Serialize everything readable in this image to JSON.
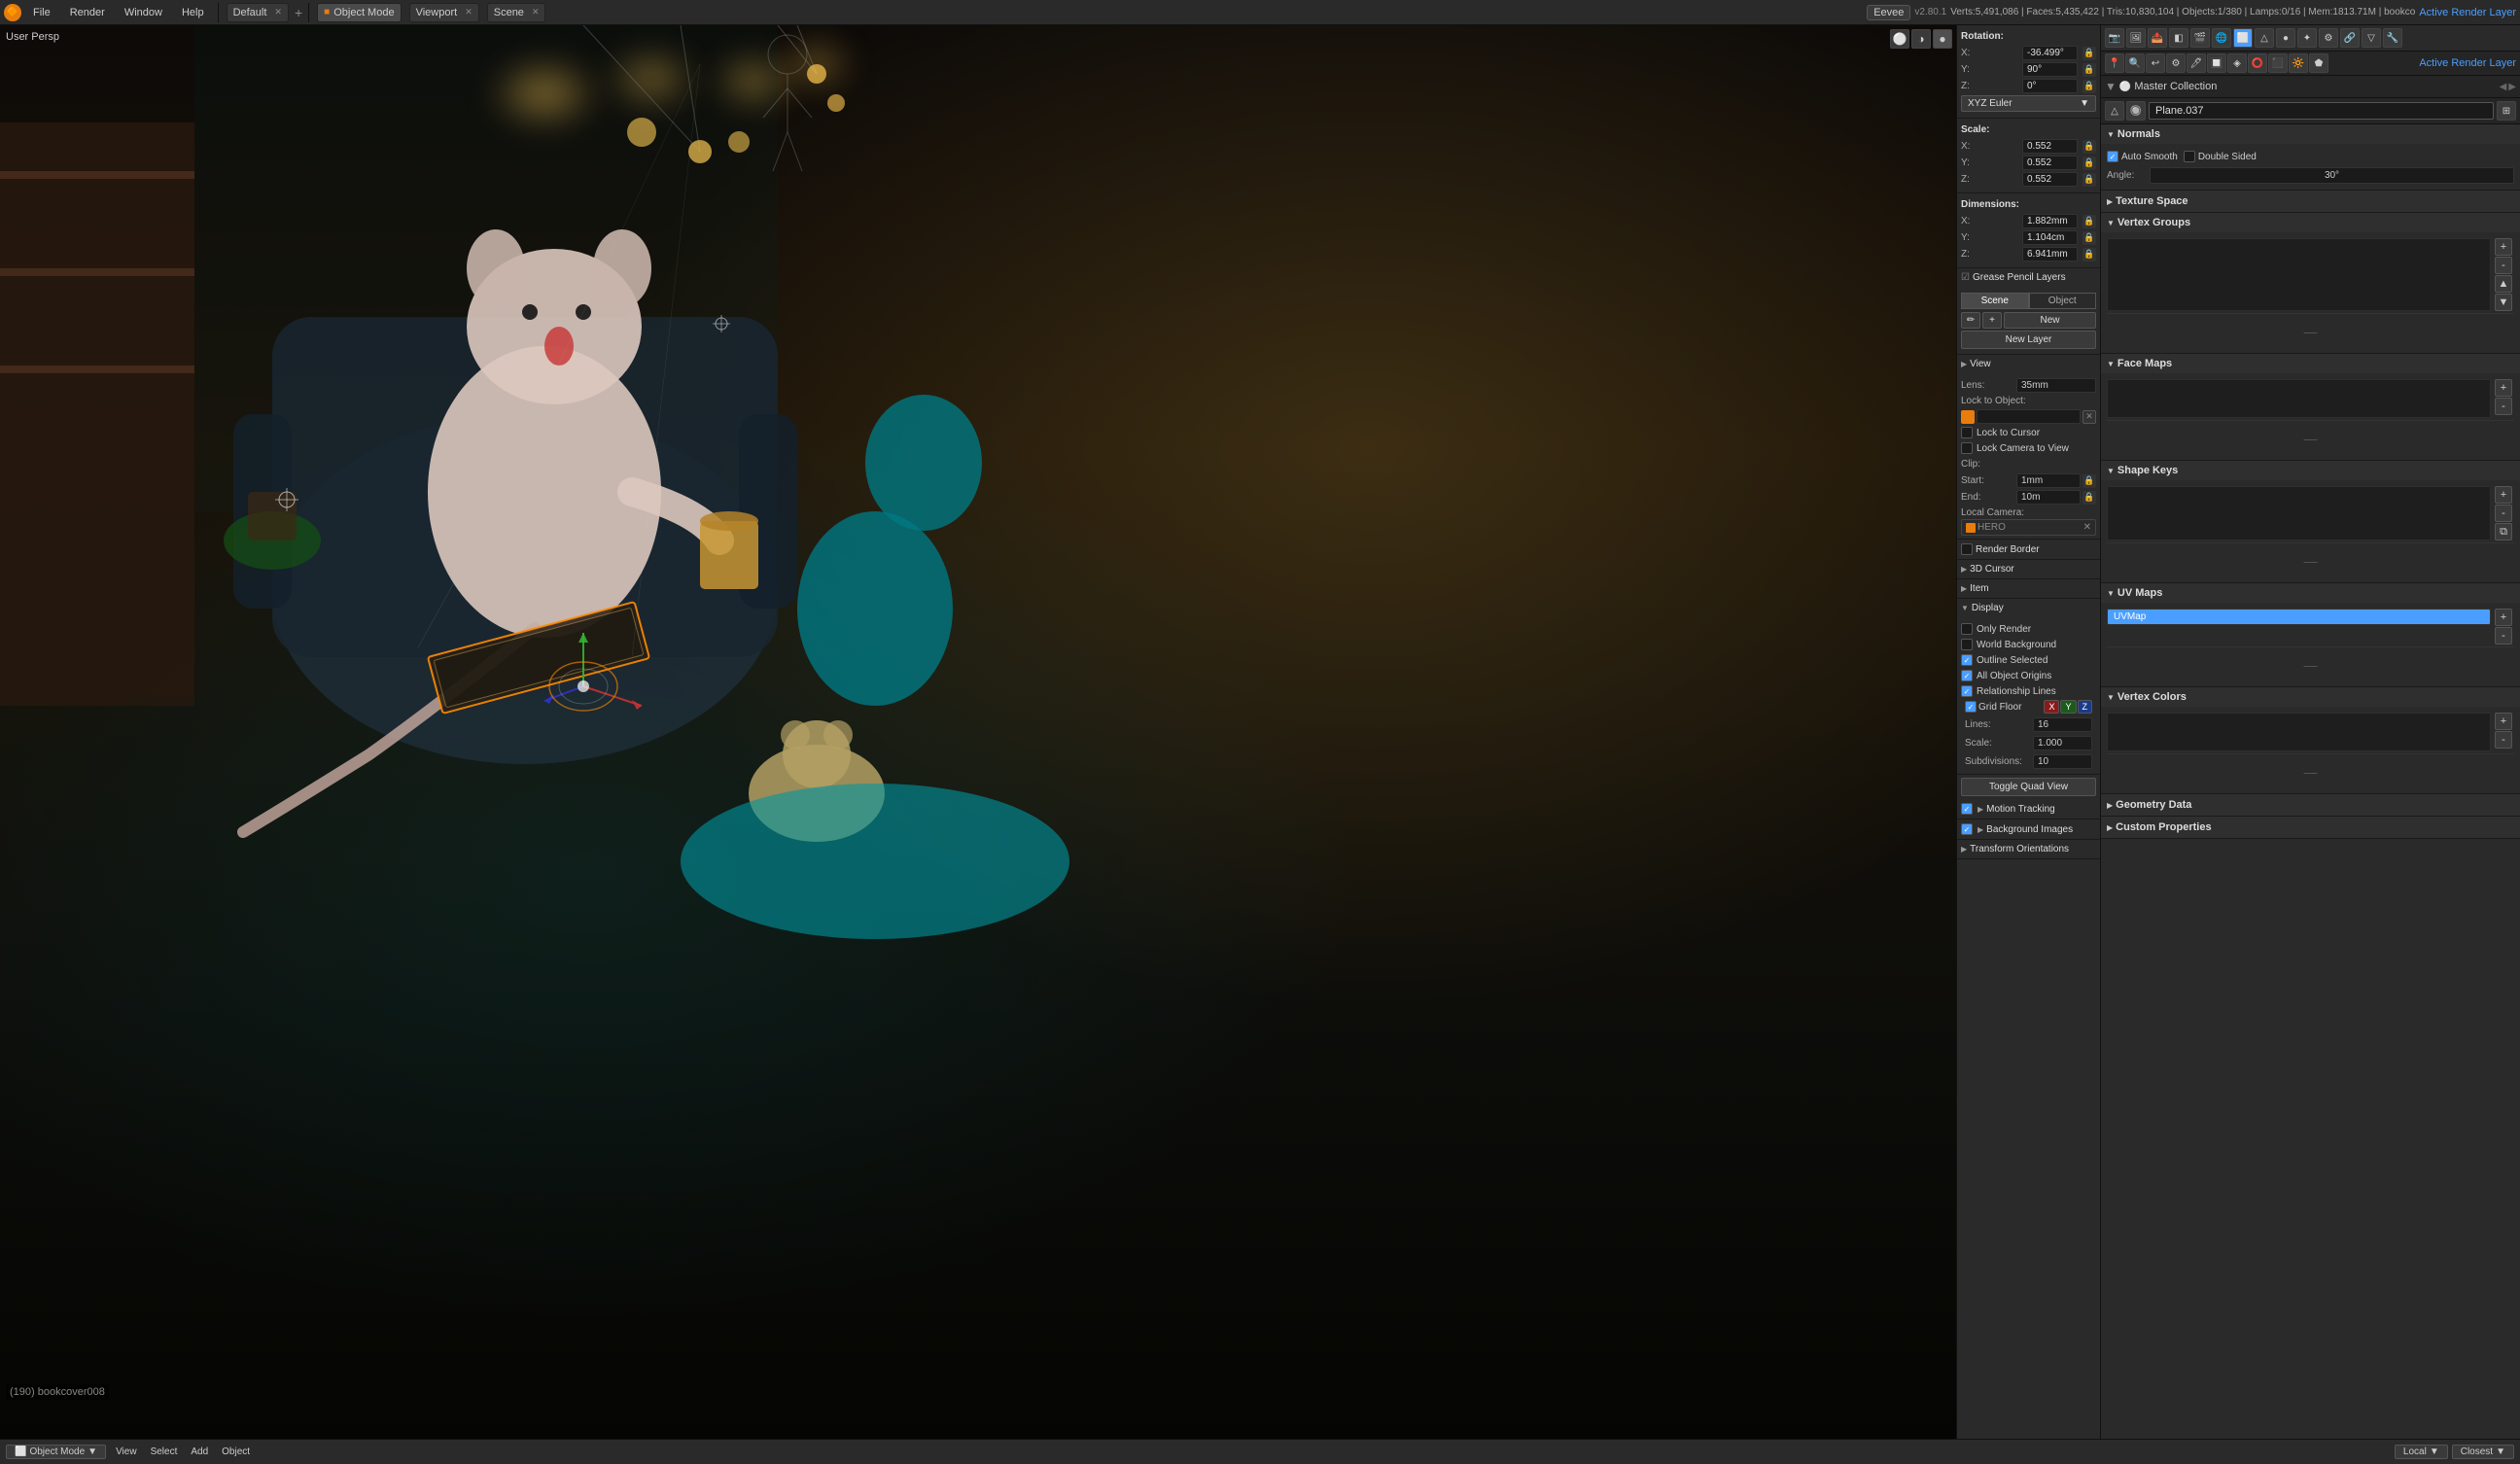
{
  "window": {
    "title": "Blender",
    "version": "v2.80.1",
    "stats": "Verts:5,491,086 | Faces:5,435,422 | Tris:10,830,104 | Objects:1/380 | Lamps:0/16 | Mem:1813.71M | bookco"
  },
  "topbar": {
    "workspace": "Default",
    "mode": "Object Mode",
    "editor": "Viewport",
    "scene": "Scene",
    "engine": "Eevee",
    "menus": [
      "File",
      "Render",
      "Window",
      "Help"
    ],
    "active_render_layer": "Active Render Layer"
  },
  "viewport": {
    "label": "User Persp",
    "object_name": "(190) bookcover008"
  },
  "properties": {
    "rotation": {
      "title": "Rotation:",
      "x_label": "X:",
      "x_value": "-36.499°",
      "y_label": "Y:",
      "y_value": "90°",
      "z_label": "Z:",
      "z_value": "0°",
      "mode": "XYZ Euler"
    },
    "scale": {
      "title": "Scale:",
      "x_label": "X:",
      "x_value": "0.552",
      "y_label": "Y:",
      "y_value": "0.552",
      "z_label": "Z:",
      "z_value": "0.552"
    },
    "dimensions": {
      "title": "Dimensions:",
      "x_label": "X:",
      "x_value": "1.882mm",
      "y_label": "Y:",
      "y_value": "1.104cm",
      "z_label": "Z:",
      "z_value": "6.941mm"
    },
    "grease_pencil": {
      "title": "Grease Pencil Layers",
      "tab_scene": "Scene",
      "tab_object": "Object",
      "new_label": "New",
      "new_layer_label": "New Layer"
    },
    "view": {
      "title": "View",
      "lens_label": "Lens:",
      "lens_value": "35mm",
      "lock_to_obj_label": "Lock to Object:",
      "lock_cursor_label": "Lock to Cursor",
      "lock_camera_label": "Lock Camera to View",
      "clip_title": "Clip:",
      "clip_start_label": "Start:",
      "clip_start_value": "1mm",
      "clip_end_label": "End:",
      "clip_end_value": "10m",
      "local_camera_label": "Local Camera:",
      "local_camera_value": "HERO",
      "render_border_label": "Render Border",
      "cursor_3d_label": "3D Cursor",
      "item_label": "Item"
    },
    "display": {
      "title": "Display",
      "only_render": "Only Render",
      "world_bg": "World Background",
      "outline_selected": "Outline Selected",
      "all_obj_origins": "All Object Origins",
      "relationship_lines": "Relationship Lines",
      "grid_floor": "Grid Floor",
      "grid_x": "X",
      "grid_y": "Y",
      "grid_z": "Z",
      "lines_label": "Lines:",
      "lines_value": "16",
      "scale_label": "Scale:",
      "scale_value": "1.000",
      "subdivisions_label": "Subdivisions:",
      "subdivisions_value": "10",
      "toggle_quad": "Toggle Quad View"
    },
    "motion_tracking": {
      "title": "Motion Tracking"
    },
    "background_images": {
      "title": "Background Images"
    },
    "transform_orientations": {
      "title": "Transform Orientations"
    }
  },
  "object_properties": {
    "toolbar_icons": [
      "camera",
      "render",
      "output",
      "view-layer",
      "scene",
      "world",
      "object",
      "mesh",
      "material",
      "particles",
      "physics",
      "constraints",
      "object-data",
      "modifiers"
    ],
    "active_render_layer": "Active Render Layer",
    "collection": "Master Collection",
    "plane_name": "Plane.037",
    "normals": {
      "title": "Normals",
      "auto_smooth": "Auto Smooth",
      "double_sided": "Double Sided",
      "angle_label": "Angle:",
      "angle_value": "30°"
    },
    "texture_space": {
      "title": "Texture Space"
    },
    "vertex_groups": {
      "title": "Vertex Groups",
      "add_btn": "+",
      "remove_btn": "-",
      "move_up_btn": "▲",
      "move_down_btn": "▼"
    },
    "face_maps": {
      "title": "Face Maps",
      "add_btn": "+",
      "remove_btn": "-"
    },
    "shape_keys": {
      "title": "Shape Keys",
      "add_btn": "+",
      "remove_btn": "-",
      "copy_btn": "⧉"
    },
    "uv_maps": {
      "title": "UV Maps",
      "active_map": "UVMap",
      "add_btn": "+",
      "remove_btn": "-"
    },
    "vertex_colors": {
      "title": "Vertex Colors",
      "add_btn": "+",
      "remove_btn": "-"
    },
    "geometry_data": {
      "title": "Geometry Data"
    },
    "custom_properties": {
      "title": "Custom Properties"
    }
  },
  "bottom_bar": {
    "items": [
      "View",
      "Select",
      "Add",
      "Object"
    ],
    "mode": "Object Mode",
    "transform": "Local",
    "snap": "Closest"
  }
}
